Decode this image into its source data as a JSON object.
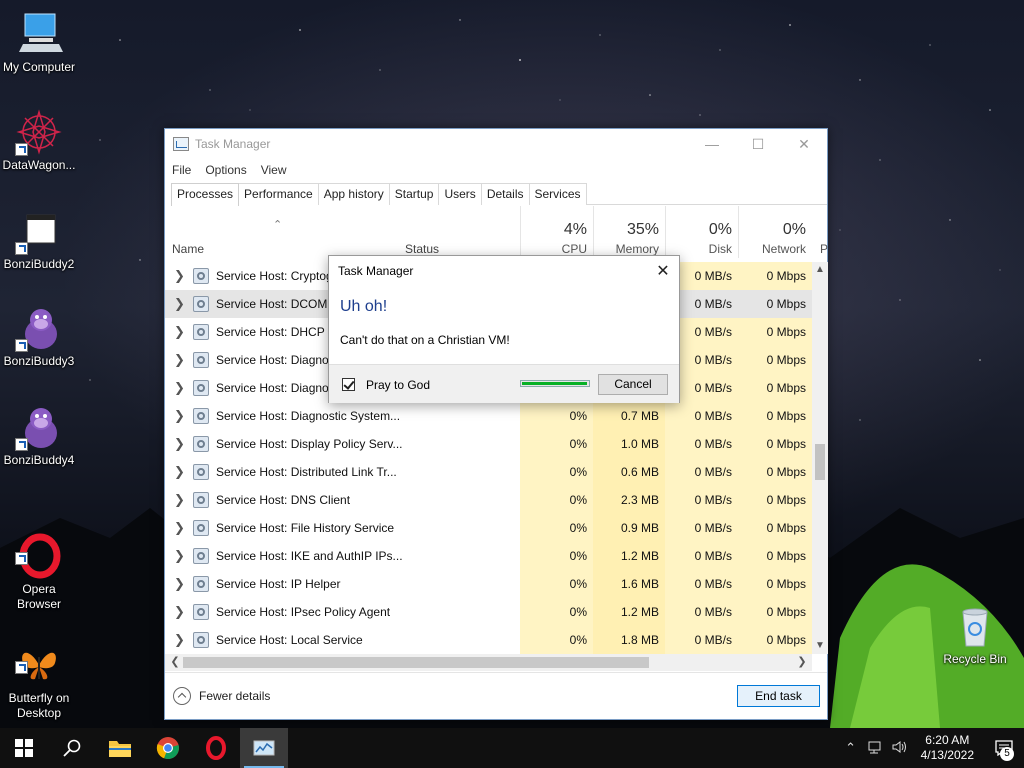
{
  "desktop": {
    "icons": [
      {
        "label": "My Computer"
      },
      {
        "label": "DataWagon..."
      },
      {
        "label": "BonziBuddy2"
      },
      {
        "label": "BonziBuddy3"
      },
      {
        "label": "BonziBuddy4"
      },
      {
        "label": "Opera\nBrowser"
      },
      {
        "label": "Butterfly on\nDesktop"
      },
      {
        "label": "Recycle Bin"
      }
    ]
  },
  "task_manager": {
    "title": "Task Manager",
    "menu": [
      "File",
      "Options",
      "View"
    ],
    "tabs": [
      "Processes",
      "Performance",
      "App history",
      "Startup",
      "Users",
      "Details",
      "Services"
    ],
    "columns": {
      "name": "Name",
      "status": "Status",
      "cpu": {
        "pct": "4%",
        "label": "CPU"
      },
      "memory": {
        "pct": "35%",
        "label": "Memory"
      },
      "disk": {
        "pct": "0%",
        "label": "Disk"
      },
      "network": {
        "pct": "0%",
        "label": "Network"
      },
      "power": "P"
    },
    "rows": [
      {
        "name": "Service Host: Cryptog",
        "cpu": "",
        "mem": "",
        "disk": "0 MB/s",
        "net": "0 Mbps"
      },
      {
        "name": "Service Host: DCOM S",
        "cpu": "",
        "mem": "",
        "disk": "0 MB/s",
        "net": "0 Mbps"
      },
      {
        "name": "Service Host: DHCP C",
        "cpu": "",
        "mem": "",
        "disk": "0 MB/s",
        "net": "0 Mbps"
      },
      {
        "name": "Service Host: Diagnos",
        "cpu": "",
        "mem": "",
        "disk": "0 MB/s",
        "net": "0 Mbps"
      },
      {
        "name": "Service Host: Diagnos",
        "cpu": "",
        "mem": "",
        "disk": "0 MB/s",
        "net": "0 Mbps"
      },
      {
        "name": "Service Host: Diagnostic System...",
        "cpu": "0%",
        "mem": "0.7 MB",
        "disk": "0 MB/s",
        "net": "0 Mbps"
      },
      {
        "name": "Service Host: Display Policy Serv...",
        "cpu": "0%",
        "mem": "1.0 MB",
        "disk": "0 MB/s",
        "net": "0 Mbps"
      },
      {
        "name": "Service Host: Distributed Link Tr...",
        "cpu": "0%",
        "mem": "0.6 MB",
        "disk": "0 MB/s",
        "net": "0 Mbps"
      },
      {
        "name": "Service Host: DNS Client",
        "cpu": "0%",
        "mem": "2.3 MB",
        "disk": "0 MB/s",
        "net": "0 Mbps"
      },
      {
        "name": "Service Host: File History Service",
        "cpu": "0%",
        "mem": "0.9 MB",
        "disk": "0 MB/s",
        "net": "0 Mbps"
      },
      {
        "name": "Service Host: IKE and AuthIP IPs...",
        "cpu": "0%",
        "mem": "1.2 MB",
        "disk": "0 MB/s",
        "net": "0 Mbps"
      },
      {
        "name": "Service Host: IP Helper",
        "cpu": "0%",
        "mem": "1.6 MB",
        "disk": "0 MB/s",
        "net": "0 Mbps"
      },
      {
        "name": "Service Host: IPsec Policy Agent",
        "cpu": "0%",
        "mem": "1.2 MB",
        "disk": "0 MB/s",
        "net": "0 Mbps"
      },
      {
        "name": "Service Host: Local Service",
        "cpu": "0%",
        "mem": "1.8 MB",
        "disk": "0 MB/s",
        "net": "0 Mbps"
      }
    ],
    "fewer_details": "Fewer details",
    "end_task": "End task"
  },
  "dialog": {
    "title": "Task Manager",
    "heading": "Uh oh!",
    "message": "Can't do that on a Christian VM!",
    "checkbox_label": "Pray to God",
    "checkbox_checked": true,
    "progress_fraction": 0.98,
    "cancel": "Cancel"
  },
  "taskbar": {
    "time": "6:20 AM",
    "date": "4/13/2022",
    "notification_count": "5"
  }
}
